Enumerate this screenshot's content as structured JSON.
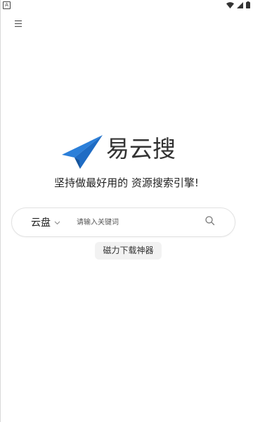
{
  "status_bar": {
    "left_icon": "A",
    "wifi_icon": "wifi-icon",
    "signal_icon": "signal-icon",
    "battery_icon": "battery-icon"
  },
  "header": {
    "menu_icon": "hamburger-menu-icon"
  },
  "logo": {
    "icon": "paper-plane-icon",
    "title": "易云搜",
    "brand_color": "#2b7fd9"
  },
  "slogan": "坚持做最好用的 资源搜索引擎!",
  "search": {
    "source_selected": "云盘",
    "placeholder": "请输入关键词",
    "value": "",
    "search_icon": "search-icon"
  },
  "magnet_button": {
    "label": "磁力下载神器"
  }
}
